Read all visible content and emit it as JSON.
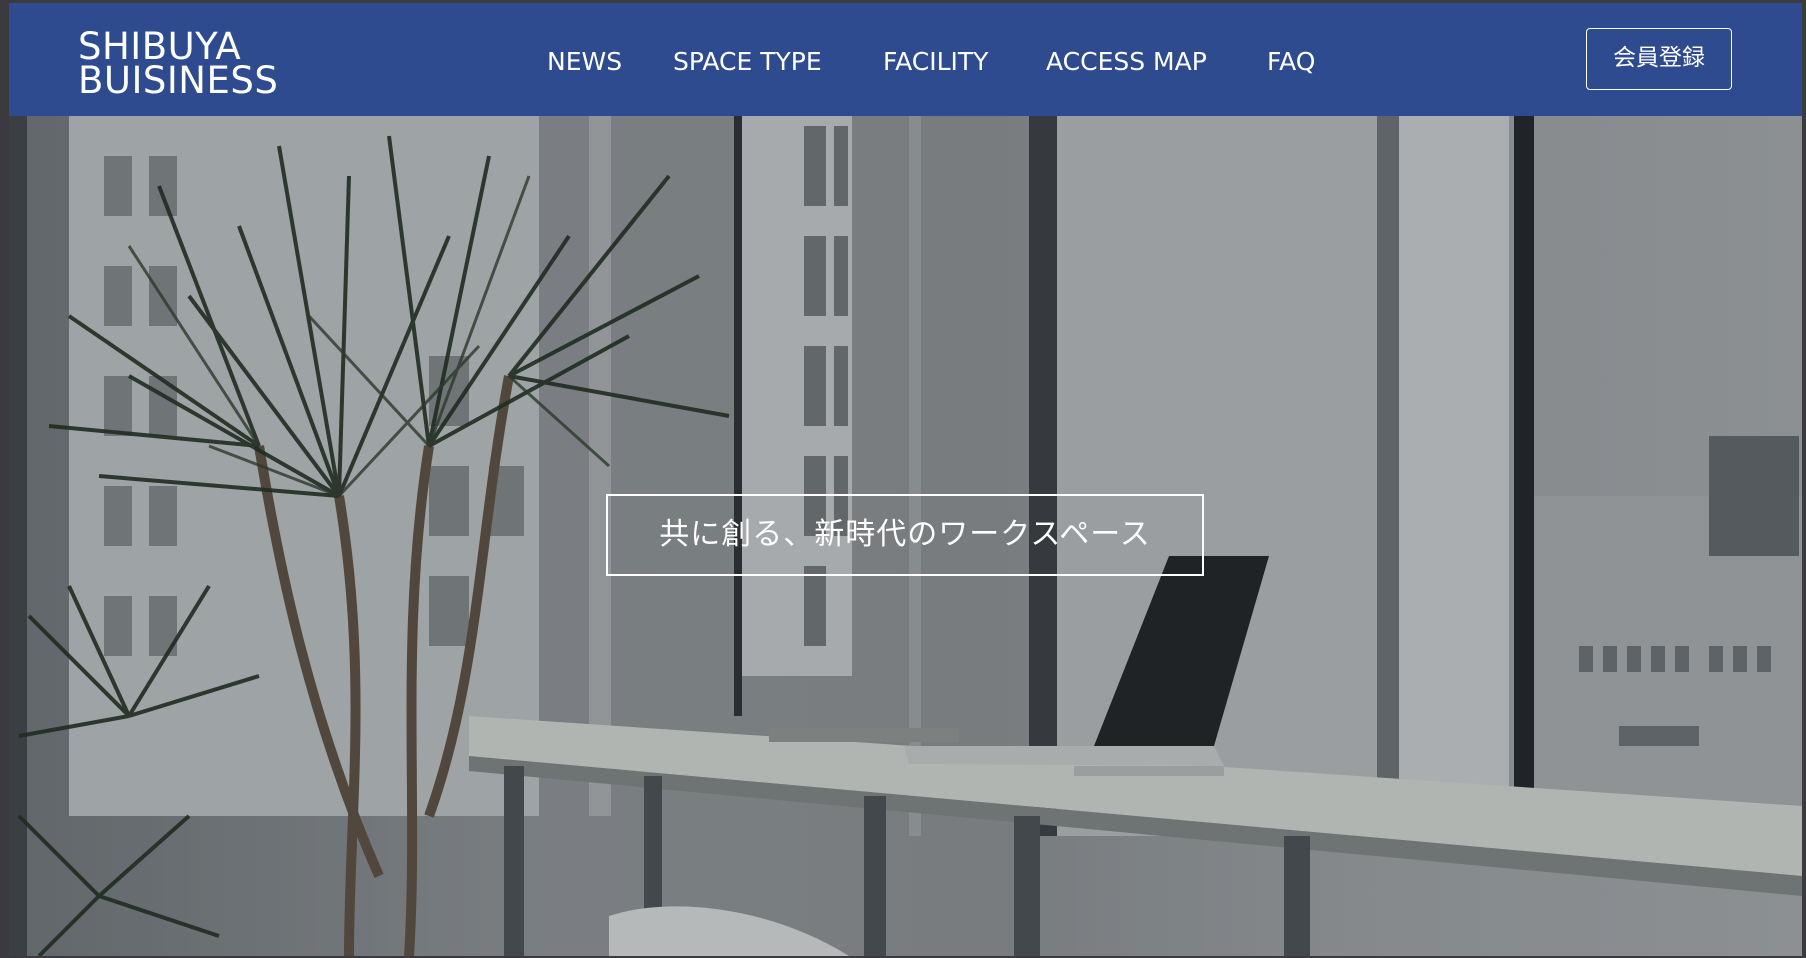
{
  "header": {
    "logo_line1": "SHIBUYA",
    "logo_line2": "BUISINESS",
    "register_label": "会員登録",
    "background_color": "#2f4b8f"
  },
  "nav": {
    "items": [
      {
        "label": "NEWS"
      },
      {
        "label": "SPACE TYPE"
      },
      {
        "label": "FACILITY"
      },
      {
        "label": "ACCESS MAP"
      },
      {
        "label": "FAQ"
      }
    ]
  },
  "hero": {
    "tagline": "共に創る、新時代のワークスペース",
    "image": "office-workspace-photo"
  }
}
